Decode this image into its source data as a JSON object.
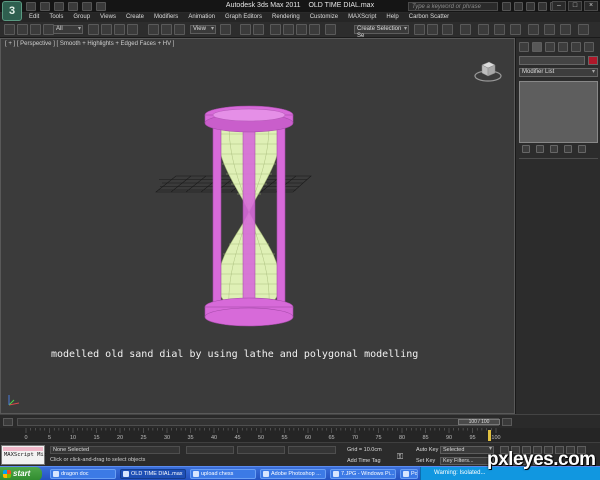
{
  "window": {
    "title_app": "Autodesk 3ds Max  2011",
    "title_file": "OLD TIME DIAL.max",
    "search_placeholder": "Type a keyword or phrase"
  },
  "menu": [
    "Edit",
    "Tools",
    "Group",
    "Views",
    "Create",
    "Modifiers",
    "Animation",
    "Graph Editors",
    "Rendering",
    "Customize",
    "MAXScript",
    "Help",
    "Carbon Scatter"
  ],
  "toolbar": {
    "selection_filter": "All",
    "reference_coord": "View",
    "named_selection": "Create Selection Se"
  },
  "viewport": {
    "label": "[ + ] [ Perspective ] [ Smooth + Highlights + Edged Faces + HV ]",
    "caption": "modelled old sand dial by using lathe and polygonal modelling",
    "object_frame_color": "#d76ad9",
    "glass_color": "#dff0b6",
    "background_color": "#3b3b3b"
  },
  "command_panel": {
    "modifier_list": "Modifier List",
    "object_color": "#b0182a"
  },
  "timeslider": {
    "frame_label": "100 / 100"
  },
  "trackbar": {
    "ticks": [
      "0",
      "5",
      "10",
      "15",
      "20",
      "25",
      "30",
      "35",
      "40",
      "45",
      "50",
      "55",
      "60",
      "65",
      "70",
      "75",
      "80",
      "85",
      "90",
      "95",
      "100"
    ]
  },
  "status": {
    "maxscript_label": "MAXScript Mi:",
    "selection": "None Selected",
    "prompt": "Click or click-and-drag to select objects",
    "grid": "Grid = 10.0cm",
    "add_time_tag": "Add Time Tag",
    "auto_key": "Auto Key",
    "set_key": "Set Key",
    "selected_option": "Selected",
    "key_filters": "Key Filters..."
  },
  "taskbar": {
    "start_label": "start",
    "tasks": [
      "dragon doc",
      "OLD TIME DIAL.max",
      "upload chess",
      "Adobe Photoshop ...",
      "7.JPG - Windows Pi...",
      "Portable Photogr..."
    ],
    "tray_note": "Warning: Isolated..."
  },
  "watermark": "pxleyes.com"
}
